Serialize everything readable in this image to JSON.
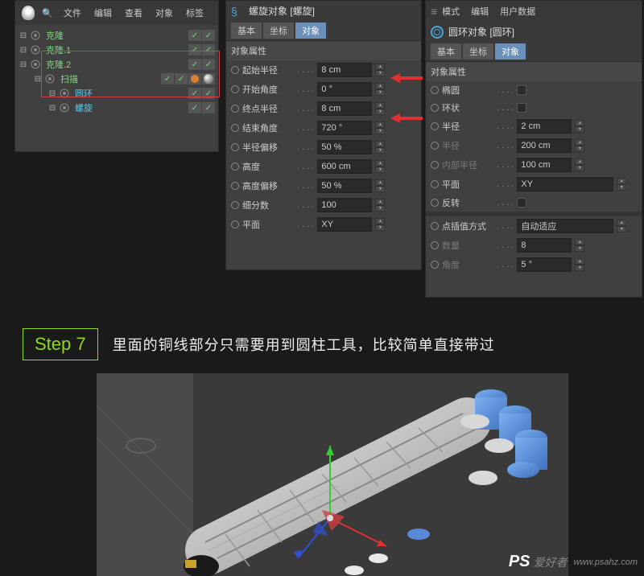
{
  "panel1": {
    "menu": [
      "文件",
      "编辑",
      "查看",
      "对象",
      "标签"
    ],
    "rows": [
      {
        "label": "克隆",
        "cls": "grn",
        "indent": 0,
        "tags": [
          "check",
          "check"
        ]
      },
      {
        "label": "克隆.1",
        "cls": "grn",
        "indent": 0,
        "tags": [
          "check",
          "check"
        ]
      },
      {
        "label": "克隆.2",
        "cls": "grn",
        "indent": 0,
        "tags": [
          "check",
          "check"
        ]
      },
      {
        "label": "扫描",
        "cls": "grn",
        "indent": 1,
        "tags": [
          "check",
          "check",
          "orange",
          "sphere"
        ]
      },
      {
        "label": "圆环",
        "cls": "cyan",
        "indent": 2,
        "tags": [
          "check",
          "check"
        ]
      },
      {
        "label": "螺旋",
        "cls": "cyan",
        "indent": 2,
        "tags": [
          "check",
          "check"
        ]
      }
    ]
  },
  "panel2": {
    "title": "螺旋对象 [螺旋]",
    "tabs": [
      "基本",
      "坐标",
      "对象"
    ],
    "section": "对象属性",
    "props": [
      {
        "label": "起始半径",
        "value": "8 cm"
      },
      {
        "label": "开始角度",
        "value": "0 °"
      },
      {
        "label": "终点半径",
        "value": "8 cm"
      },
      {
        "label": "结束角度",
        "value": "720 °"
      },
      {
        "label": "半径偏移",
        "value": "50 %"
      },
      {
        "label": "高度",
        "value": "600 cm"
      },
      {
        "label": "高度偏移",
        "value": "50 %"
      },
      {
        "label": "细分数",
        "value": "100"
      },
      {
        "label": "平面",
        "value": "XY"
      }
    ]
  },
  "panel3": {
    "menu": [
      "模式",
      "编辑",
      "用户数据"
    ],
    "title": "圆环对象 [圆环]",
    "tabs": [
      "基本",
      "坐标",
      "对象"
    ],
    "section": "对象属性",
    "props": [
      {
        "label": "椭圆",
        "type": "check"
      },
      {
        "label": "环状",
        "type": "check"
      },
      {
        "label": "半径",
        "value": "2 cm"
      },
      {
        "label": "半径",
        "value": "200 cm",
        "dim": true
      },
      {
        "label": "内部半径",
        "value": "100 cm",
        "dim": true
      },
      {
        "label": "平面",
        "value": "XY",
        "wide": true
      },
      {
        "label": "反转",
        "type": "check"
      }
    ],
    "props2": [
      {
        "label": "点插值方式",
        "value": "自动适应",
        "wide": true
      },
      {
        "label": "数量",
        "value": "8",
        "dim": true
      },
      {
        "label": "角度",
        "value": "5 °",
        "dim": true
      }
    ]
  },
  "step": {
    "label": "Step 7",
    "text": "里面的铜线部分只需要用到圆柱工具，比较简单直接带过"
  },
  "watermark": {
    "logo": "PS",
    "text": "爱好者",
    "url": "www.psahz.com"
  }
}
